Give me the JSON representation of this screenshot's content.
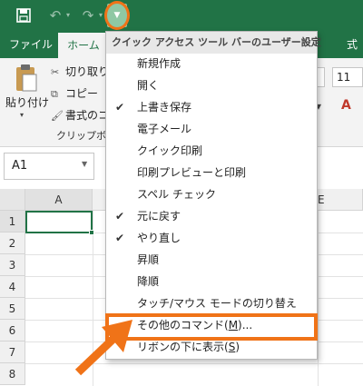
{
  "qat": {
    "save_icon": "save-icon",
    "undo_icon": "undo-icon",
    "redo_icon": "redo-icon",
    "customize_icon": "dropdown-arrow-icon"
  },
  "tabs": {
    "file": "ファイル",
    "home": "ホーム",
    "right_partial": "式"
  },
  "ribbon": {
    "paste": "貼り付け",
    "cut": "切り取り",
    "copy": "コピー",
    "format_painter": "書式のコ",
    "clipboard_group": "クリップボー",
    "font_size": "11"
  },
  "namebox": {
    "value": "A1"
  },
  "grid": {
    "columns": [
      "A",
      "E"
    ],
    "rows": [
      "1",
      "2",
      "3",
      "4",
      "5",
      "6",
      "7",
      "8"
    ]
  },
  "menu": {
    "header": "クイック アクセス ツール バーのユーザー設定",
    "items": [
      {
        "label": "新規作成",
        "checked": false
      },
      {
        "label": "開く",
        "checked": false
      },
      {
        "label": "上書き保存",
        "checked": true
      },
      {
        "label": "電子メール",
        "checked": false
      },
      {
        "label": "クイック印刷",
        "checked": false
      },
      {
        "label": "印刷プレビューと印刷",
        "checked": false
      },
      {
        "label": "スペル チェック",
        "checked": false
      },
      {
        "label": "元に戻す",
        "checked": true
      },
      {
        "label": "やり直し",
        "checked": true
      },
      {
        "label": "昇順",
        "checked": false
      },
      {
        "label": "降順",
        "checked": false
      },
      {
        "label": "タッチ/マウス モードの切り替え",
        "checked": false
      }
    ],
    "more_commands": {
      "prefix": "その他のコマンド(",
      "key": "M",
      "suffix": ")..."
    },
    "show_below": {
      "prefix": "リボンの下に表示(",
      "key": "S",
      "suffix": ")"
    }
  },
  "colors": {
    "excel_green": "#217346",
    "highlight_orange": "#f07318"
  }
}
